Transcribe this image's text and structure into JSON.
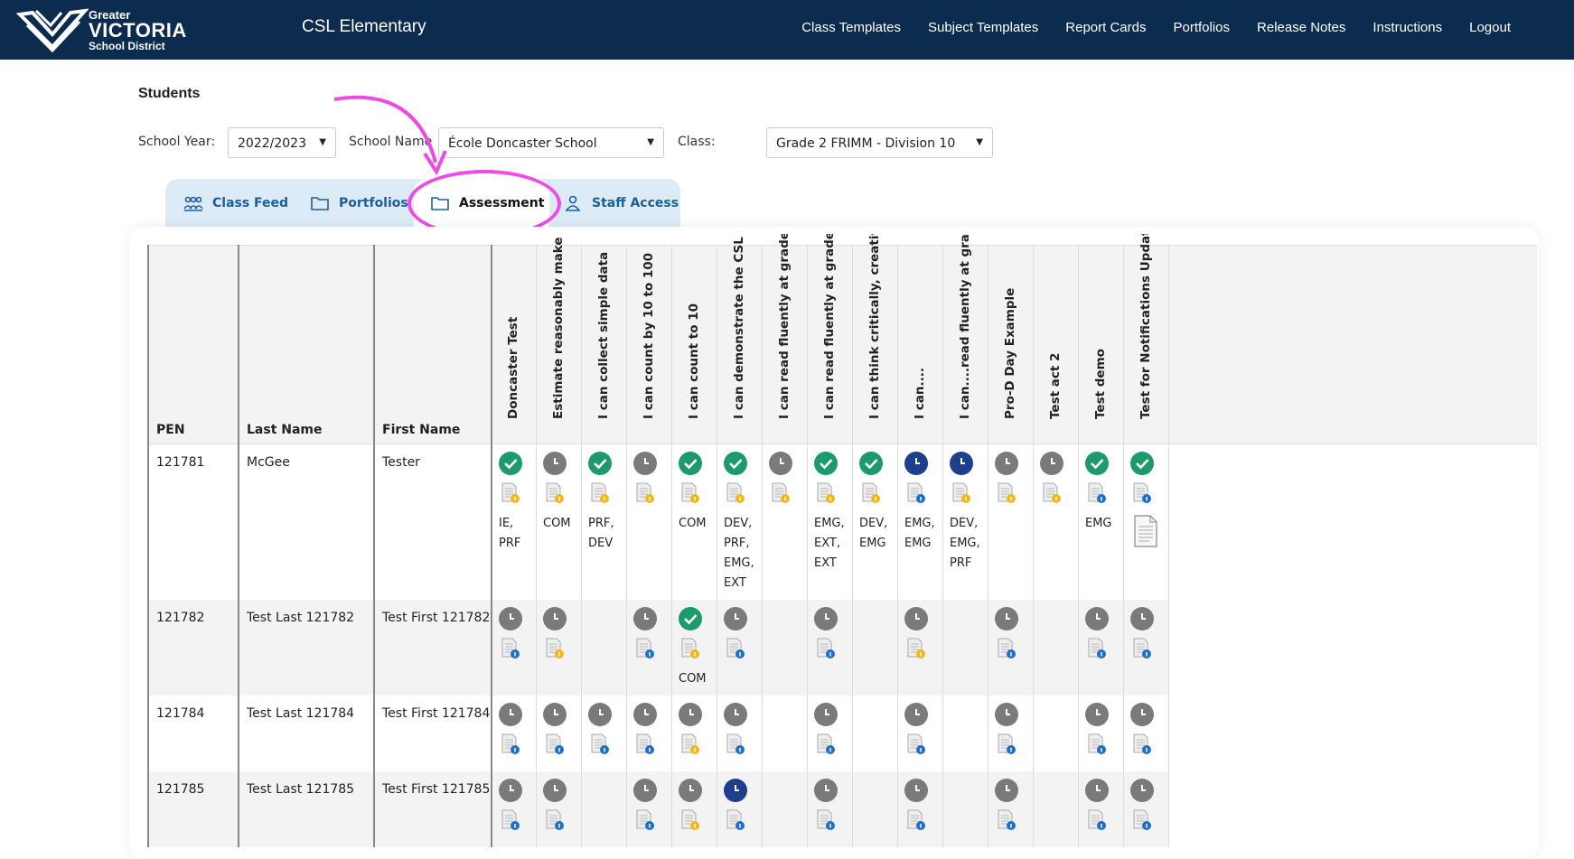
{
  "header": {
    "logo": {
      "line1": "Greater",
      "line2": "VICTORIA",
      "line3": "School District"
    },
    "school_title": "CSL Elementary",
    "nav": [
      "Class Templates",
      "Subject Templates",
      "Report Cards",
      "Portfolios",
      "Release Notes",
      "Instructions",
      "Logout"
    ]
  },
  "page": {
    "heading": "Students",
    "filters": {
      "school_year_label": "School Year:",
      "school_year_value": "2022/2023",
      "school_name_label": "School Name",
      "school_name_value": "École Doncaster School",
      "class_label": "Class:",
      "class_value": "Grade 2 FRIMM - Division 10"
    },
    "tabs": [
      {
        "label": "Class Feed",
        "icon": "people-icon"
      },
      {
        "label": "Portfolios",
        "icon": "folder-icon"
      },
      {
        "label": "Assessment",
        "icon": "folder-open-icon",
        "active": true
      },
      {
        "label": "Staff Access",
        "icon": "person-icon"
      }
    ],
    "annotation_color": "#ee4be4"
  },
  "table": {
    "fixed_headers": [
      "PEN",
      "Last Name",
      "First Name"
    ],
    "assessment_headers": [
      "Doncaster Test",
      "Estimate reasonably make pr",
      "I can collect simple data",
      "I can count by 10 to 100",
      "I can count to 10",
      "I can demonstrate the CSL po",
      "I can read fluently at grade le",
      "I can read fluently at grade le",
      "I can think critically, creativel",
      "I can....",
      "I can....read fluently at grade l",
      "Pro-D Day Example",
      "Test act 2",
      "Test demo",
      "Test for Notifications Update"
    ],
    "rows": [
      {
        "pen": "121781",
        "last": "McGee",
        "first": "Tester",
        "cells": [
          {
            "status": "check",
            "doc": "yellow",
            "codes": [
              "IE,",
              "PRF"
            ]
          },
          {
            "status": "clock",
            "doc": "yellow",
            "codes": [
              "COM"
            ]
          },
          {
            "status": "check",
            "doc": "yellow",
            "codes": [
              "PRF,",
              "DEV"
            ]
          },
          {
            "status": "clock",
            "doc": "yellow",
            "codes": []
          },
          {
            "status": "check",
            "doc": "yellow",
            "codes": [
              "COM"
            ]
          },
          {
            "status": "check",
            "doc": "yellow",
            "codes": [
              "DEV,",
              "PRF,",
              "EMG,",
              "EXT"
            ]
          },
          {
            "status": "clock",
            "doc": "yellow",
            "codes": []
          },
          {
            "status": "check",
            "doc": "yellow",
            "codes": [
              "EMG,",
              "EXT,",
              "EXT"
            ]
          },
          {
            "status": "check",
            "doc": "yellow",
            "codes": [
              "DEV,",
              "EMG"
            ]
          },
          {
            "status": "dclock",
            "doc": "blue",
            "codes": [
              "EMG,",
              "EMG"
            ]
          },
          {
            "status": "dclock",
            "doc": "yellow",
            "codes": [
              "DEV,",
              "EMG,",
              "PRF"
            ]
          },
          {
            "status": "clock",
            "doc": "yellow",
            "codes": []
          },
          {
            "status": "clock",
            "doc": "yellow",
            "codes": []
          },
          {
            "status": "check",
            "doc": "blue",
            "codes": [
              "EMG"
            ]
          },
          {
            "status": "check",
            "doc": "blue",
            "codes": [],
            "bigdoc": true
          }
        ]
      },
      {
        "pen": "121782",
        "last": "Test Last 121782",
        "first": "Test First 121782",
        "cells": [
          {
            "status": "clock",
            "doc": "blue",
            "codes": []
          },
          {
            "status": "clock",
            "doc": "yellow",
            "codes": []
          },
          {
            "status": "none",
            "doc": "none",
            "codes": []
          },
          {
            "status": "clock",
            "doc": "blue",
            "codes": []
          },
          {
            "status": "check",
            "doc": "yellow",
            "codes": [
              "COM"
            ]
          },
          {
            "status": "clock",
            "doc": "blue",
            "codes": []
          },
          {
            "status": "none",
            "doc": "none",
            "codes": []
          },
          {
            "status": "clock",
            "doc": "blue",
            "codes": []
          },
          {
            "status": "none",
            "doc": "none",
            "codes": []
          },
          {
            "status": "clock",
            "doc": "yellow",
            "codes": []
          },
          {
            "status": "none",
            "doc": "none",
            "codes": []
          },
          {
            "status": "clock",
            "doc": "blue",
            "codes": []
          },
          {
            "status": "none",
            "doc": "none",
            "codes": []
          },
          {
            "status": "clock",
            "doc": "blue",
            "codes": []
          },
          {
            "status": "clock",
            "doc": "blue",
            "codes": []
          }
        ]
      },
      {
        "pen": "121784",
        "last": "Test Last 121784",
        "first": "Test First 121784",
        "cells": [
          {
            "status": "clock",
            "doc": "blue",
            "codes": []
          },
          {
            "status": "clock",
            "doc": "blue",
            "codes": []
          },
          {
            "status": "clock",
            "doc": "blue",
            "codes": []
          },
          {
            "status": "clock",
            "doc": "blue",
            "codes": []
          },
          {
            "status": "clock",
            "doc": "yellow",
            "codes": []
          },
          {
            "status": "clock",
            "doc": "blue",
            "codes": []
          },
          {
            "status": "none",
            "doc": "none",
            "codes": []
          },
          {
            "status": "clock",
            "doc": "blue",
            "codes": []
          },
          {
            "status": "none",
            "doc": "none",
            "codes": []
          },
          {
            "status": "clock",
            "doc": "blue",
            "codes": []
          },
          {
            "status": "none",
            "doc": "none",
            "codes": []
          },
          {
            "status": "clock",
            "doc": "blue",
            "codes": []
          },
          {
            "status": "none",
            "doc": "none",
            "codes": []
          },
          {
            "status": "clock",
            "doc": "blue",
            "codes": []
          },
          {
            "status": "clock",
            "doc": "blue",
            "codes": []
          }
        ]
      },
      {
        "pen": "121785",
        "last": "Test Last 121785",
        "first": "Test First 121785",
        "cells": [
          {
            "status": "clock",
            "doc": "blue",
            "codes": []
          },
          {
            "status": "clock",
            "doc": "blue",
            "codes": []
          },
          {
            "status": "none",
            "doc": "none",
            "codes": []
          },
          {
            "status": "clock",
            "doc": "blue",
            "codes": []
          },
          {
            "status": "clock",
            "doc": "yellow",
            "codes": []
          },
          {
            "status": "dclock",
            "doc": "blue",
            "codes": []
          },
          {
            "status": "none",
            "doc": "none",
            "codes": []
          },
          {
            "status": "clock",
            "doc": "blue",
            "codes": []
          },
          {
            "status": "none",
            "doc": "none",
            "codes": []
          },
          {
            "status": "clock",
            "doc": "blue",
            "codes": []
          },
          {
            "status": "none",
            "doc": "none",
            "codes": []
          },
          {
            "status": "clock",
            "doc": "blue",
            "codes": []
          },
          {
            "status": "none",
            "doc": "none",
            "codes": []
          },
          {
            "status": "clock",
            "doc": "blue",
            "codes": []
          },
          {
            "status": "clock",
            "doc": "blue",
            "codes": []
          }
        ]
      }
    ]
  }
}
